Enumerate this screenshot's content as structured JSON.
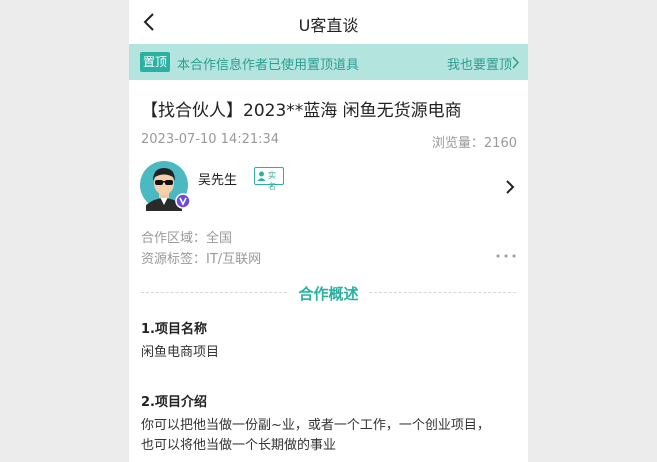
{
  "nav": {
    "title": "U客直谈"
  },
  "banner": {
    "badge": "置顶",
    "text": "本合作信息作者已使用置顶道具",
    "link": "我也要置顶"
  },
  "post": {
    "title": "【找合伙人】2023**蓝海 闲鱼无货源电商",
    "time": "2023-07-10 14:21:34",
    "views_label": "浏览量：",
    "views_count": "2160"
  },
  "author": {
    "name": "吴先生",
    "verified": "实名"
  },
  "meta": {
    "region": "合作区域：全国",
    "tags": "资源标签：IT/互联网"
  },
  "section": {
    "title": "合作概述"
  },
  "fields": [
    {
      "heading": "1.项目名称",
      "value": "闲鱼电商项目"
    },
    {
      "heading": "2.项目介绍",
      "value": "你可以把他当做一份副~业，或者一个工作，一个创业项目，也可以将他当做一个长期做的事业"
    }
  ],
  "colors": {
    "accent": "#2bb1a2",
    "banner_bg": "#b3e4de",
    "vip": "#6a4cdf"
  }
}
